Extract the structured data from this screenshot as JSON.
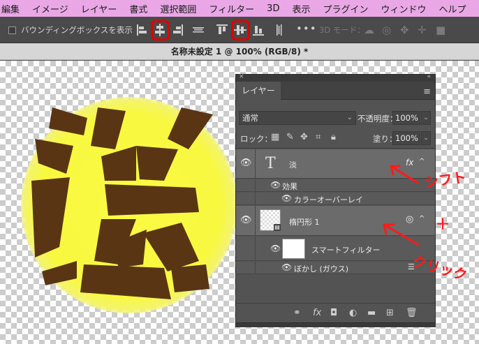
{
  "menu": [
    "編集",
    "イメージ",
    "レイヤー",
    "書式",
    "選択範囲",
    "フィルター",
    "3D",
    "表示",
    "プラグイン",
    "ウィンドウ",
    "ヘルプ"
  ],
  "options": {
    "bounding_box_label": "バウンディングボックスを表示",
    "mode3d_label": "3D モード：",
    "more": "•••"
  },
  "document": {
    "title": "名称未設定 1 @ 100% (RGB/8) *"
  },
  "layers_panel": {
    "tab": "レイヤー",
    "blend_mode": "通常",
    "opacity_label": "不透明度：",
    "opacity_value": "100%",
    "lock_label": "ロック：",
    "fill_label": "塗り：",
    "fill_value": "100%",
    "layers": [
      {
        "name": "淡",
        "type": "text",
        "fx": "fx",
        "effects_label": "効果",
        "effects": [
          "カラーオーバーレイ"
        ]
      },
      {
        "name": "楕円形 1",
        "type": "smart",
        "filters_label": "スマートフィルター",
        "filters": [
          "ぼかし (ガウス)"
        ]
      }
    ]
  },
  "canvas": {
    "glyph_color": "#5a3514",
    "glow_color": "#f7f742"
  },
  "annotations": {
    "shift_word": "シフト",
    "plus": "＋",
    "click_word": "クリック",
    "color": "#ff1a1a"
  }
}
